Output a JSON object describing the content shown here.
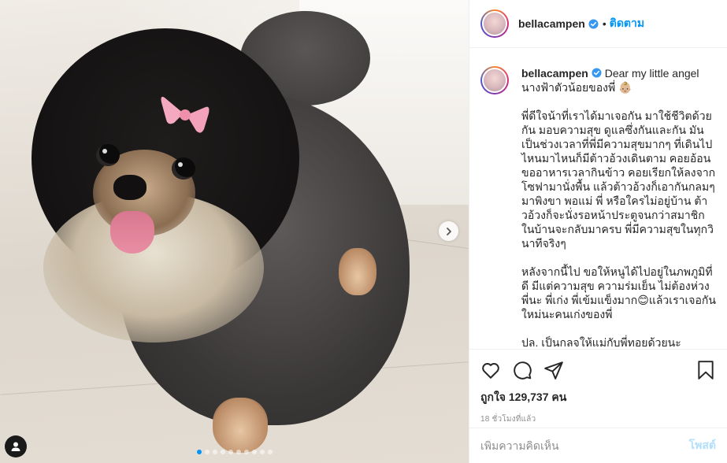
{
  "post": {
    "username": "bellacampen",
    "header_separator": "•",
    "follow_label": "ติดตาม",
    "carousel": {
      "slide_count": 10,
      "active_index": 0
    }
  },
  "caption": {
    "username": "bellacampen",
    "title": "Dear my little angel",
    "subtitle": "นางฟ้าตัวน้อยของพี่ 👶🏼",
    "paragraphs": [
      "พี่ดีใจน้าที่เราได้มาเจอกัน มาใช้ชีวิตด้วยกัน มอบความสุข ดูแลซึ่งกันและกัน มันเป็นช่วงเวลาที่พี่มีความสุขมากๆ ที่เดินไปไหนมาไหนก็มีต้าวอ้วงเดินตาม คอยอ้อนขออาหารเวลากินข้าว คอยเรียกให้ลงจากโซฟามานั่งพื้น แล้วต้าวอ้วงก็เอากันกลมๆ มาพิงขา พอแม่ พี่ หรือใครไม่อยู่บ้าน ต้าวอ้วงก็จะนั่งรอหน้าประตูจนกว่าสมาชิกในบ้านจะกลับมาครบ พี่มีความสุขในทุกวินาทีจริงๆ",
      "หลังจากนี้ไป ขอให้หนูได้ไปอยู่ในภพภูมิที่ดี มีแต่ความสุข ความร่มเย็น ไม่ต้องห่วงพี่นะ พี่เก่ง พี่เข้มแข็งมาก😊แล้วเราเจอกันใหม่นะคนเก่งของพี่",
      "ปล. เป็นกลจให้แม่กับพี่ทอยด้วยนะ"
    ]
  },
  "engagement": {
    "likes_text": "ถูกใจ 129,737 คน",
    "timestamp": "18 ชั่วโมงที่แล้ว"
  },
  "comment_box": {
    "placeholder": "เพิ่มความคิดเห็น",
    "post_label": "โพสต์"
  },
  "icons": {
    "like": "heart-icon",
    "comment": "comment-icon",
    "share": "share-icon",
    "save": "bookmark-icon",
    "verified": "verified-badge-icon",
    "next": "chevron-right-icon",
    "tag": "user-tag-icon"
  },
  "colors": {
    "accent": "#0095f6",
    "text": "#262626",
    "muted": "#8e8e8e",
    "post_disabled": "#b2dffc",
    "tongue": "#e88ea3",
    "bow": "#f5a9c0"
  }
}
